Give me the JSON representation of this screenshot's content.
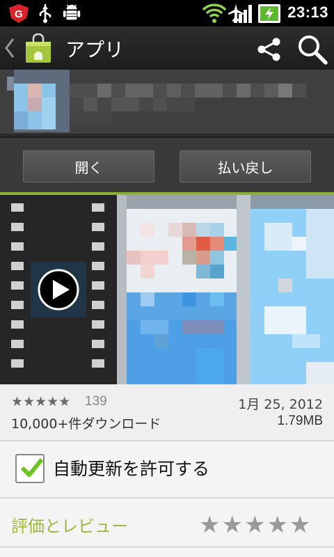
{
  "status_bar": {
    "time": "23:13",
    "icons": [
      "g-antivirus-icon",
      "usb-icon",
      "android-debug-icon",
      "wifi-icon",
      "airplane-icon",
      "signal-icon",
      "battery-charging-icon"
    ]
  },
  "action_bar": {
    "title": "アプリ",
    "icons": [
      "back-chevron-icon",
      "play-store-bag-icon",
      "share-icon",
      "search-icon"
    ]
  },
  "buttons": {
    "open": "開く",
    "refund": "払い戻し"
  },
  "info": {
    "stars_display": "★★★★★",
    "rating_count": "139",
    "date": "1月 25, 2012",
    "downloads": "10,000+件ダウンロード",
    "size": "1.79MB"
  },
  "auto_update": {
    "label": "自動更新を許可する",
    "checked": true
  },
  "reviews": {
    "title": "評価とレビュー",
    "stars_display": "★★★★★"
  },
  "colors": {
    "accent_green": "#8db23a",
    "reviews_title": "#9cba3b",
    "action_bar": "#262626"
  }
}
